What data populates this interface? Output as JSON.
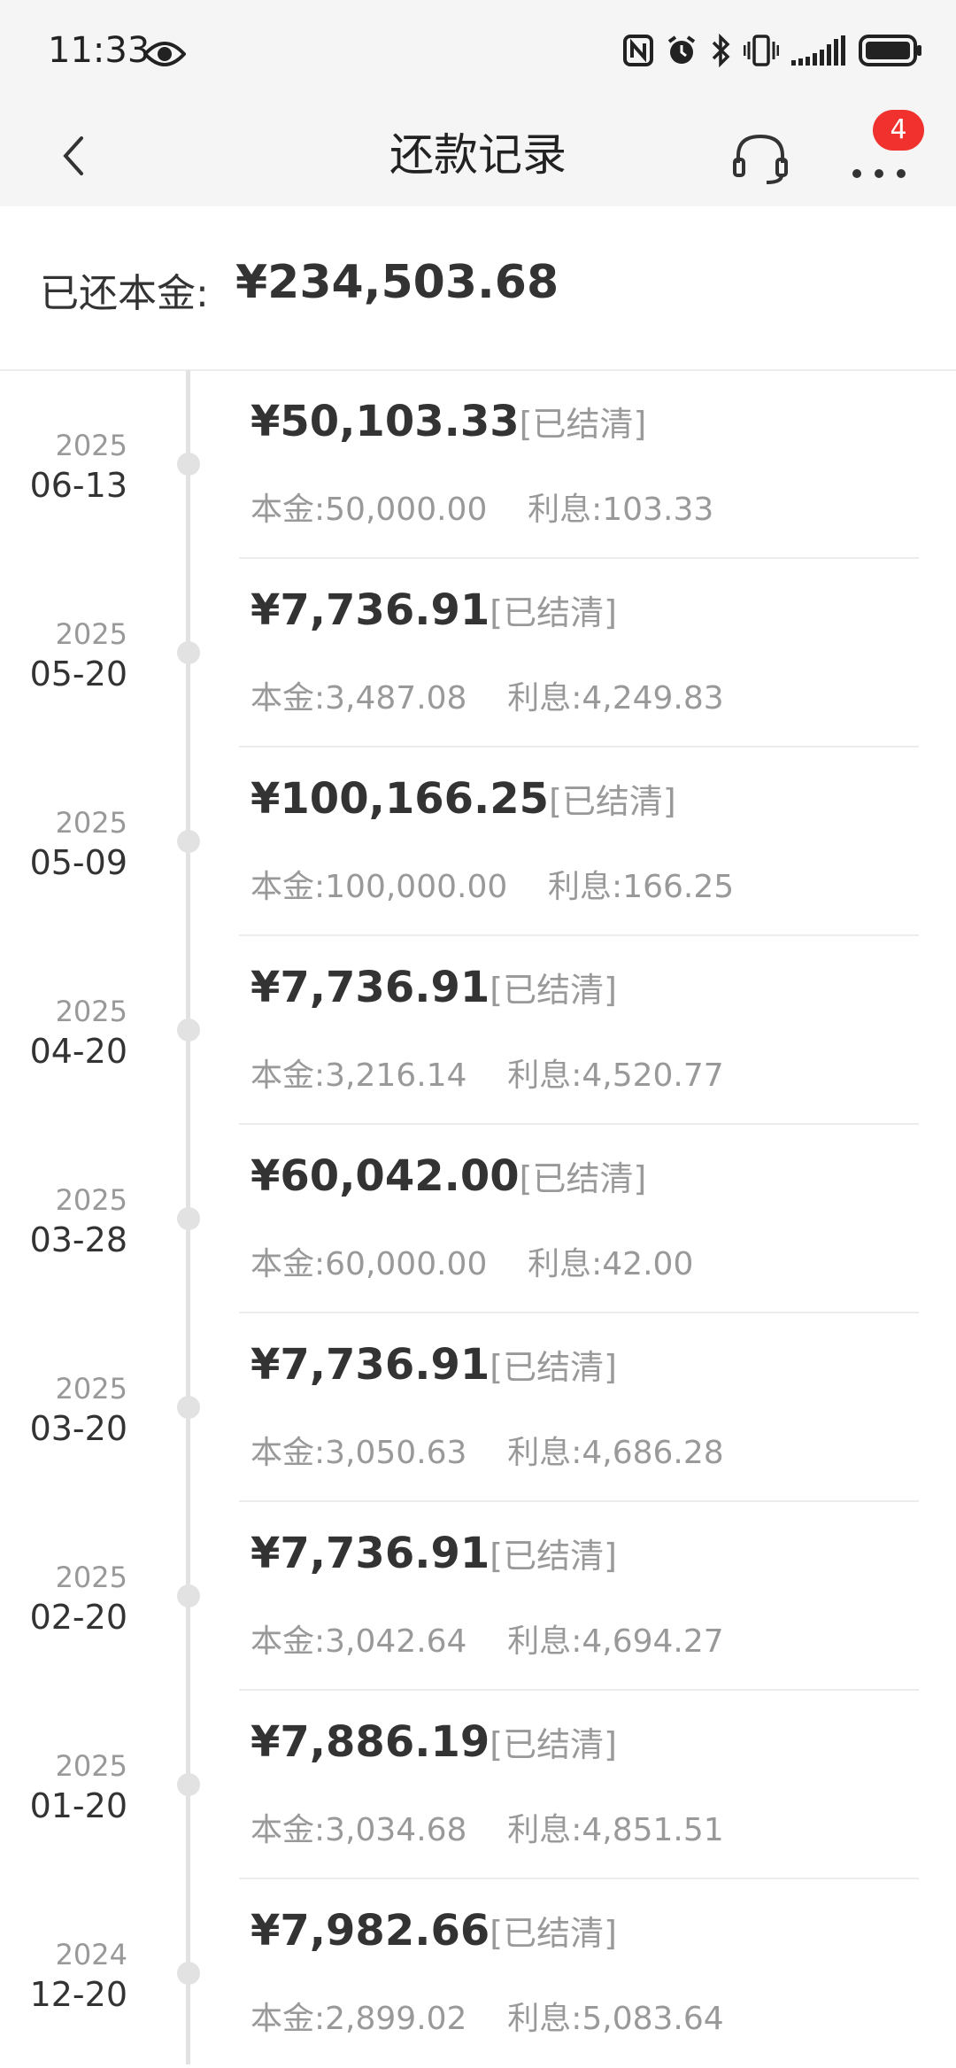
{
  "status_bar": {
    "time": "11:33",
    "battery": "battery-icon"
  },
  "header": {
    "title": "还款记录",
    "badge_count": "4"
  },
  "summary": {
    "label": "已还本金:",
    "value": "¥234,503.68"
  },
  "records": [
    {
      "year": "2025",
      "date": "06-13",
      "amount": "¥50,103.33",
      "status": "[已结清]",
      "principal_label": "本金:",
      "principal": "50,000.00",
      "interest_label": "利息:",
      "interest": "103.33"
    },
    {
      "year": "2025",
      "date": "05-20",
      "amount": "¥7,736.91",
      "status": "[已结清]",
      "principal_label": "本金:",
      "principal": "3,487.08",
      "interest_label": "利息:",
      "interest": "4,249.83"
    },
    {
      "year": "2025",
      "date": "05-09",
      "amount": "¥100,166.25",
      "status": "[已结清]",
      "principal_label": "本金:",
      "principal": "100,000.00",
      "interest_label": "利息:",
      "interest": "166.25"
    },
    {
      "year": "2025",
      "date": "04-20",
      "amount": "¥7,736.91",
      "status": "[已结清]",
      "principal_label": "本金:",
      "principal": "3,216.14",
      "interest_label": "利息:",
      "interest": "4,520.77"
    },
    {
      "year": "2025",
      "date": "03-28",
      "amount": "¥60,042.00",
      "status": "[已结清]",
      "principal_label": "本金:",
      "principal": "60,000.00",
      "interest_label": "利息:",
      "interest": "42.00"
    },
    {
      "year": "2025",
      "date": "03-20",
      "amount": "¥7,736.91",
      "status": "[已结清]",
      "principal_label": "本金:",
      "principal": "3,050.63",
      "interest_label": "利息:",
      "interest": "4,686.28"
    },
    {
      "year": "2025",
      "date": "02-20",
      "amount": "¥7,736.91",
      "status": "[已结清]",
      "principal_label": "本金:",
      "principal": "3,042.64",
      "interest_label": "利息:",
      "interest": "4,694.27"
    },
    {
      "year": "2025",
      "date": "01-20",
      "amount": "¥7,886.19",
      "status": "[已结清]",
      "principal_label": "本金:",
      "principal": "3,034.68",
      "interest_label": "利息:",
      "interest": "4,851.51"
    },
    {
      "year": "2024",
      "date": "12-20",
      "amount": "¥7,982.66",
      "status": "[已结清]",
      "principal_label": "本金:",
      "principal": "2,899.02",
      "interest_label": "利息:",
      "interest": "5,083.64"
    }
  ]
}
